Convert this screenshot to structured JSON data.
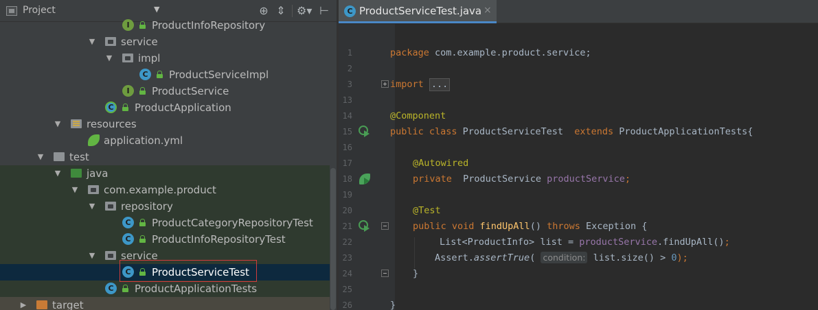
{
  "project_panel": {
    "title": "Project",
    "dropdown_icon": "triangle-down",
    "toolbar_icons": [
      "locate-icon",
      "collapse-all-icon",
      "gear-icon",
      "hide-panel-icon"
    ],
    "tree": [
      {
        "label": "ProductInfoRepository",
        "icon": "interface-icon",
        "expanded": null
      },
      {
        "label": "service",
        "icon": "package-folder-icon",
        "expanded": true
      },
      {
        "label": "impl",
        "icon": "package-folder-icon",
        "expanded": true
      },
      {
        "label": "ProductServiceImpl",
        "icon": "class-icon",
        "expanded": null
      },
      {
        "label": "ProductService",
        "icon": "interface-icon",
        "expanded": null
      },
      {
        "label": "ProductApplication",
        "icon": "spring-boot-app-icon",
        "expanded": null
      },
      {
        "label": "resources",
        "icon": "resources-folder-icon",
        "expanded": true
      },
      {
        "label": "application.yml",
        "icon": "spring-config-icon",
        "expanded": null
      },
      {
        "label": "test",
        "icon": "folder-icon",
        "expanded": true
      },
      {
        "label": "java",
        "icon": "test-source-folder-icon",
        "expanded": true
      },
      {
        "label": "com.example.product",
        "icon": "package-folder-icon",
        "expanded": true
      },
      {
        "label": "repository",
        "icon": "package-folder-icon",
        "expanded": true
      },
      {
        "label": "ProductCategoryRepositoryTest",
        "icon": "test-class-icon",
        "expanded": null
      },
      {
        "label": "ProductInfoRepositoryTest",
        "icon": "test-class-icon",
        "expanded": null
      },
      {
        "label": "service",
        "icon": "package-folder-icon",
        "expanded": true
      },
      {
        "label": "ProductServiceTest",
        "icon": "test-class-icon",
        "expanded": null,
        "selected": true
      },
      {
        "label": "ProductApplicationTests",
        "icon": "test-class-icon",
        "expanded": null
      },
      {
        "label": "target",
        "icon": "excluded-folder-icon",
        "expanded": false
      }
    ]
  },
  "editor": {
    "tab": {
      "title": "ProductServiceTest.java",
      "close": "×"
    },
    "line_numbers": [
      "1",
      "2",
      "3",
      "13",
      "14",
      "15",
      "16",
      "17",
      "18",
      "19",
      "20",
      "21",
      "22",
      "23",
      "24",
      "25",
      "26"
    ],
    "code": {
      "l1_kw": "package",
      "l1_rest": " com.example.product.service;",
      "l3_kw": "import",
      "l3_fold": "...",
      "l14_ann": "@Component",
      "l15_kw": "public class",
      "l15_name": " ProductServiceTest  ",
      "l15_kw2": "extends",
      "l15_rest": " ProductApplicationTests{",
      "l17_ann": "@Autowired",
      "l18_kw": "private",
      "l18_type": "  ProductService ",
      "l18_fld": "productService",
      "l18_end": ";",
      "l20_ann": "@Test",
      "l21_kw": "public void",
      "l21_mth": " findUpAll",
      "l21_mid": "() ",
      "l21_kw2": "throws",
      "l21_rest": " Exception {",
      "l22_pre": "List",
      "l22_gen": "<ProductInfo>",
      "l22_mid": " list = ",
      "l22_fld": "productService",
      "l22_rest": ".findUpAll()",
      "l22_end": ";",
      "l23_pre": "Assert.",
      "l23_mth": "assertTrue",
      "l23_paren": "( ",
      "l23_hint": "condition:",
      "l23_rest": " list.size() ",
      "l23_op": ">",
      "l23_num": " 0",
      "l23_end": ");",
      "l24": "}",
      "l26": "}"
    }
  }
}
